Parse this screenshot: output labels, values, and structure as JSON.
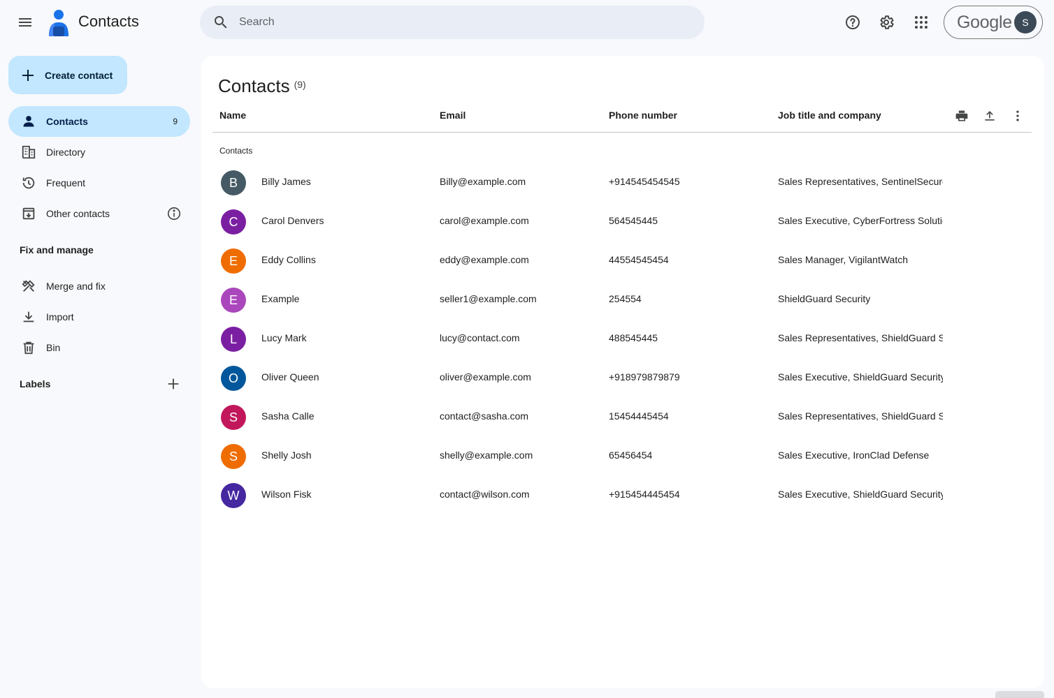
{
  "header": {
    "app_title": "Contacts",
    "search_placeholder": "Search",
    "google_word": "Google",
    "avatar_letter": "S"
  },
  "sidebar": {
    "create_label": "Create contact",
    "items": [
      {
        "label": "Contacts",
        "count": "9"
      },
      {
        "label": "Directory"
      },
      {
        "label": "Frequent"
      },
      {
        "label": "Other contacts"
      }
    ],
    "fix_manage_heading": "Fix and manage",
    "fix_items": [
      {
        "label": "Merge and fix"
      },
      {
        "label": "Import"
      },
      {
        "label": "Bin"
      }
    ],
    "labels_heading": "Labels"
  },
  "main": {
    "title": "Contacts",
    "count": "(9)",
    "columns": {
      "name": "Name",
      "email": "Email",
      "phone": "Phone number",
      "job": "Job title and company"
    },
    "group_label": "Contacts",
    "rows": [
      {
        "initial": "B",
        "color": "#455a64",
        "name": "Billy James",
        "email": "Billy@example.com",
        "phone": "+914545454545",
        "job": "Sales Representatives, SentinelSecure"
      },
      {
        "initial": "C",
        "color": "#7b1fa2",
        "name": "Carol Denvers",
        "email": "carol@example.com",
        "phone": "564545445",
        "job": "Sales Executive, CyberFortress Solutions"
      },
      {
        "initial": "E",
        "color": "#ef6c00",
        "name": "Eddy Collins",
        "email": "eddy@example.com",
        "phone": "44554545454",
        "job": "Sales Manager, VigilantWatch"
      },
      {
        "initial": "E",
        "color": "#ab47bc",
        "name": "Example",
        "email": "seller1@example.com",
        "phone": "254554",
        "job": "ShieldGuard Security"
      },
      {
        "initial": "L",
        "color": "#7b1fa2",
        "name": "Lucy Mark",
        "email": "lucy@contact.com",
        "phone": "488545445",
        "job": "Sales Representatives, ShieldGuard Security"
      },
      {
        "initial": "O",
        "color": "#01579b",
        "name": "Oliver Queen",
        "email": "oliver@example.com",
        "phone": "+918979879879",
        "job": "Sales Executive, ShieldGuard Security"
      },
      {
        "initial": "S",
        "color": "#c2185b",
        "name": "Sasha Calle",
        "email": "contact@sasha.com",
        "phone": "15454445454",
        "job": "Sales Representatives, ShieldGuard Security"
      },
      {
        "initial": "S",
        "color": "#ef6c00",
        "name": "Shelly Josh",
        "email": "shelly@example.com",
        "phone": "65456454",
        "job": "Sales Executive, IronClad Defense"
      },
      {
        "initial": "W",
        "color": "#4527a0",
        "name": "Wilson Fisk",
        "email": "contact@wilson.com",
        "phone": "+915454445454",
        "job": "Sales Executive, ShieldGuard Security"
      }
    ]
  }
}
